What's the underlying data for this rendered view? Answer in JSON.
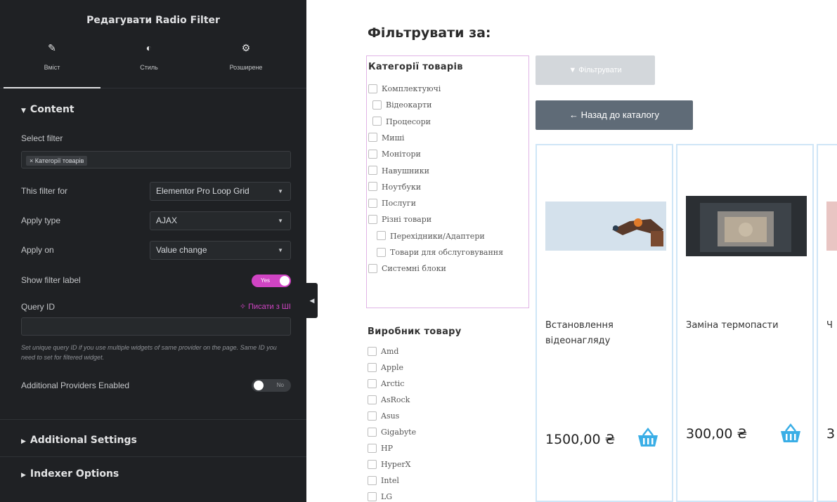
{
  "editor": {
    "title": "Редагувати Radio Filter",
    "tabs": [
      {
        "label": "Вміст",
        "icon": "pencil-icon"
      },
      {
        "label": "Стиль",
        "icon": "contrast-icon"
      },
      {
        "label": "Розширене",
        "icon": "gear-icon"
      }
    ],
    "content_section": "Content",
    "select_filter_label": "Select filter",
    "select_filter_value": "× Категорії товарів",
    "filter_for_label": "This filter for",
    "filter_for_value": "Elementor Pro Loop Grid",
    "apply_type_label": "Apply type",
    "apply_type_value": "AJAX",
    "apply_on_label": "Apply on",
    "apply_on_value": "Value change",
    "show_label_label": "Show filter label",
    "show_label_toggle": "Yes",
    "query_id_label": "Query ID",
    "query_id_ai": "✧ Писати з ШІ",
    "query_id_value": "",
    "query_help": "Set unique query ID if you use multiple widgets of same provider on the page. Same ID you need to set for filtered widget.",
    "providers_label": "Additional Providers Enabled",
    "providers_toggle": "No",
    "additional_settings": "Additional Settings",
    "indexer_options": "Indexer Options",
    "collapse_icon": "chevron-left-icon"
  },
  "preview": {
    "filter_by": "Фільтрувати за:",
    "categories_title": "Категорії товарів",
    "categories": [
      "Комплектуючі",
      "Відеокарти",
      "Процесори",
      "Миші",
      "Монітори",
      "Навушники",
      "Ноутбуки",
      "Послуги",
      "Різні товари",
      "Перехідники/Адаптери",
      "Товари для обслуговування",
      "Системні блоки"
    ],
    "manufacturer_title": "Виробник товару",
    "manufacturers": [
      "Amd",
      "Apple",
      "Arctic",
      "AsRock",
      "Asus",
      "Gigabyte",
      "HP",
      "HyperX",
      "Intel",
      "LG"
    ],
    "filter_button": "Фільтрувати",
    "filter_icon": "funnel-icon",
    "back_button": "←  Назад до каталогу",
    "products": [
      {
        "name": "Встановлення відеонагляду",
        "price": "1500,00 ₴"
      },
      {
        "name": "Заміна термопасти",
        "price": "300,00 ₴"
      },
      {
        "name": "Ч",
        "price": "3"
      }
    ],
    "cart_color": "#3aaee6"
  }
}
